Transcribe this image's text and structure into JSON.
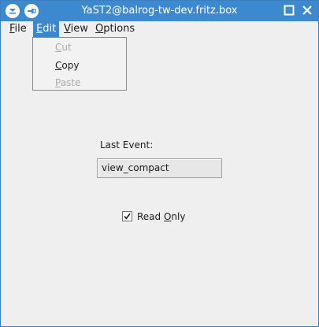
{
  "window": {
    "title": "YaST2@balrog-tw-dev.fritz.box"
  },
  "menubar": {
    "items": [
      {
        "label": "File",
        "mnemonic_index": 0
      },
      {
        "label": "Edit",
        "mnemonic_index": 0,
        "active": true
      },
      {
        "label": "View",
        "mnemonic_index": 0
      },
      {
        "label": "Options",
        "mnemonic_index": 0
      }
    ]
  },
  "edit_menu": {
    "items": [
      {
        "label": "Cut",
        "enabled": false
      },
      {
        "label": "Copy",
        "enabled": true
      },
      {
        "label": "Paste",
        "enabled": false
      }
    ]
  },
  "main": {
    "last_event_label": "Last Event:",
    "last_event_value": "view_compact",
    "read_only": {
      "label": "Read Only",
      "checked": true
    }
  },
  "colors": {
    "titlebar": "#3c89cf",
    "menu_active": "#3a87d0",
    "background": "#efefef",
    "disabled_text": "#a9a9a9"
  },
  "icons": {
    "titlebar_left": [
      "window-menu-icon",
      "pin-icon"
    ],
    "titlebar_right": [
      "maximize-icon",
      "close-icon"
    ],
    "checkbox": "checkmark-icon"
  }
}
